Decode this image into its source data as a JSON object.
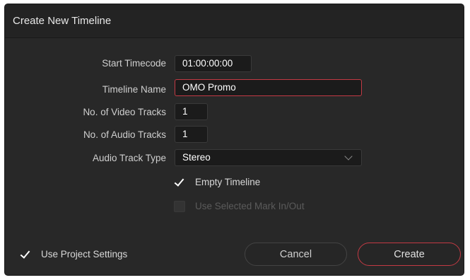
{
  "dialog": {
    "title": "Create New Timeline"
  },
  "fields": {
    "start_timecode": {
      "label": "Start Timecode",
      "value": "01:00:00:00"
    },
    "timeline_name": {
      "label": "Timeline Name",
      "value": "OMO Promo"
    },
    "video_tracks": {
      "label": "No. of Video Tracks",
      "value": "1"
    },
    "audio_tracks": {
      "label": "No. of Audio Tracks",
      "value": "1"
    },
    "audio_track_type": {
      "label": "Audio Track Type",
      "value": "Stereo"
    }
  },
  "options": {
    "empty_timeline": {
      "label": "Empty Timeline",
      "checked": true
    },
    "use_selected_mark": {
      "label": "Use Selected Mark In/Out",
      "checked": false,
      "disabled": true
    },
    "use_project_settings": {
      "label": "Use Project Settings",
      "checked": true
    }
  },
  "buttons": {
    "cancel": "Cancel",
    "create": "Create"
  },
  "colors": {
    "dialog_bg": "#282828",
    "field_bg": "#1b1b1b",
    "accent_red": "#c33a44"
  },
  "icons": {
    "dropdown": "chevron-down-icon",
    "check": "checkmark-icon"
  }
}
